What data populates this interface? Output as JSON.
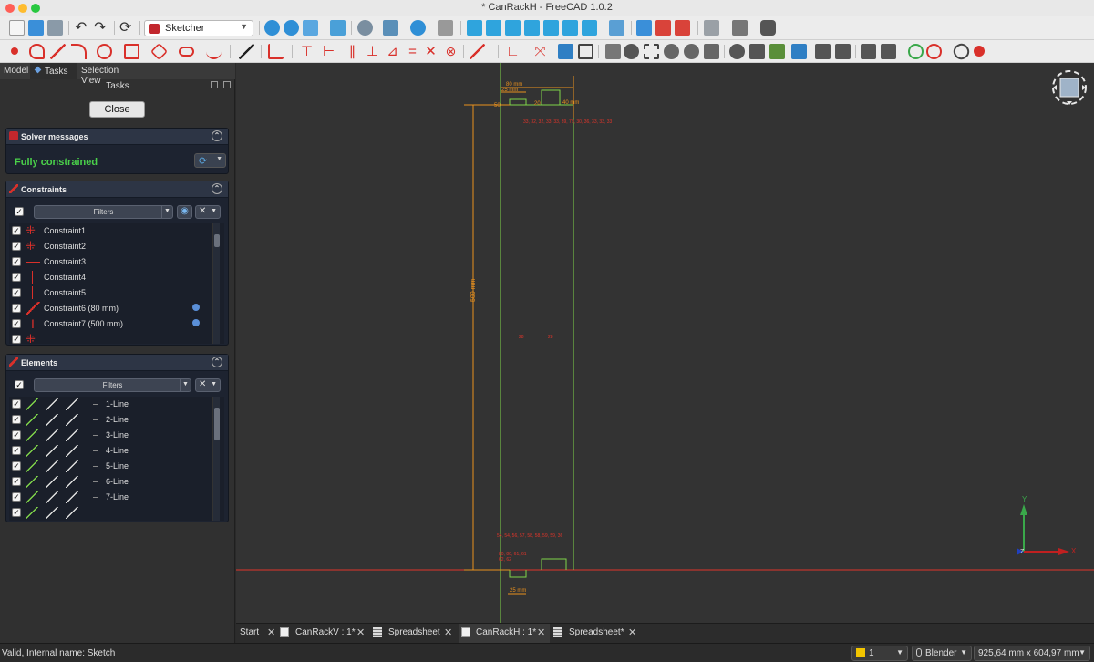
{
  "window": {
    "title": "* CanRackH - FreeCAD 1.0.2"
  },
  "toolbar": {
    "workbench": "Sketcher"
  },
  "panel": {
    "tabs": [
      "Model",
      "Tasks",
      "Selection View"
    ],
    "header": "Tasks",
    "close_label": "Close",
    "solver": {
      "title": "Solver messages",
      "status": "Fully constrained"
    },
    "constraints": {
      "title": "Constraints",
      "filter_label": "Filters",
      "items": [
        {
          "label": "Constraint1"
        },
        {
          "label": "Constraint2"
        },
        {
          "label": "Constraint3"
        },
        {
          "label": "Constraint4"
        },
        {
          "label": "Constraint5"
        },
        {
          "label": "Constraint6 (80 mm)"
        },
        {
          "label": "Constraint7 (500 mm)"
        }
      ]
    },
    "elements": {
      "title": "Elements",
      "filter_label": "Filters",
      "items": [
        {
          "label": "1-Line"
        },
        {
          "label": "2-Line"
        },
        {
          "label": "3-Line"
        },
        {
          "label": "4-Line"
        },
        {
          "label": "5-Line"
        },
        {
          "label": "6-Line"
        },
        {
          "label": "7-Line"
        }
      ]
    }
  },
  "sketch": {
    "dim_top_1": "80 mm",
    "dim_top_2": "25 mm",
    "dim_top_3": "40 mm",
    "dim_small_1": "20",
    "dim_small_2": "50",
    "dim_side": "500 mm",
    "label_top": "33, 32, 32, 33, 33, 39, 79, 30, 36, 33, 33, 33",
    "label_mid_1": "28",
    "label_mid_2": "28",
    "label_bottom_1": "54, 54, 56, 57, 58, 58, 59, 59, 36",
    "label_bottom_2": "80, 80, 61, 61",
    "label_bottom_3": "62, 62",
    "dim_bottom": "25 mm",
    "axis_y": "Y",
    "axis_x": "X",
    "axis_z": "Z"
  },
  "doc_tabs": [
    {
      "label": "Start"
    },
    {
      "label": "CanRackV : 1*"
    },
    {
      "label": "Spreadsheet"
    },
    {
      "label": "CanRackH : 1*"
    },
    {
      "label": "Spreadsheet*"
    }
  ],
  "status": {
    "message": "Valid, Internal name: Sketch",
    "layer": "1",
    "nav_style": "Blender",
    "dimensions": "925,64 mm x 604,97 mm"
  },
  "colors": {
    "accent_green": "#4ad14a",
    "sketch_orange": "#e8901e",
    "sketch_red": "#e0352b",
    "sketch_line_green": "#7fd44a"
  }
}
